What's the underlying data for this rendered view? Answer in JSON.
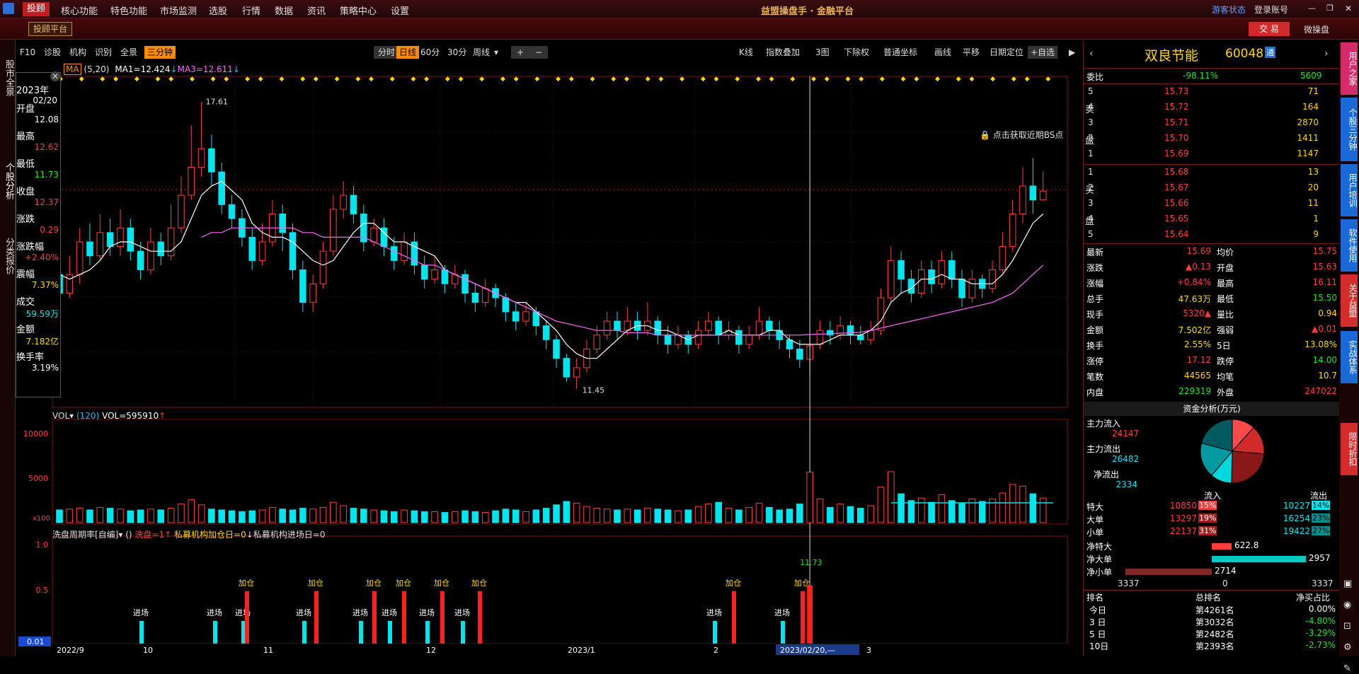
{
  "menu": {
    "items": [
      "投顾",
      "核心功能",
      "特色功能",
      "市场监测",
      "选股",
      "行情",
      "数据",
      "资讯",
      "策略中心",
      "设置"
    ],
    "title": "益盟操盘手 · 金融平台",
    "status": "游客状态",
    "login": "登录账号"
  },
  "toolbar2": {
    "advisor": "投顾平台",
    "trade": "交 易",
    "weipan": "微操盘"
  },
  "left_tabs": [
    "股市全景",
    "个股分析",
    "分类报价"
  ],
  "right_tabs": [
    "用户之家",
    "个股三分钟",
    "用户培训",
    "软件使用",
    "关于益盟",
    "实战体系",
    "限时折扣"
  ],
  "chart_toolbar": {
    "left": [
      "F10",
      "诊股",
      "机构",
      "识别",
      "全景",
      "三分钟"
    ],
    "periods": [
      "分时",
      "日线",
      "60分",
      "30分",
      "周线"
    ],
    "right": [
      "K线",
      "指数叠加",
      "3图",
      "下除权",
      "普通坐标",
      "画线",
      "平移",
      "日期定位",
      "+自选"
    ]
  },
  "ma_line": {
    "label": "MA",
    "params": "(5,20)",
    "ma1": "MA1=12.424",
    "ma3": "MA3=12.611"
  },
  "info_box": {
    "year": "2023年",
    "date": "02/20",
    "rows": [
      [
        "开盘",
        "12.08"
      ],
      [
        "最高",
        "12.62"
      ],
      [
        "最低",
        "11.73"
      ],
      [
        "收盘",
        "12.37"
      ],
      [
        "涨跌",
        "0.29"
      ],
      [
        "涨跌幅",
        "+2.40%"
      ],
      [
        "震幅",
        "7.37%"
      ],
      [
        "成交",
        "59.59万"
      ],
      [
        "金额",
        "7.182亿"
      ],
      [
        "换手率",
        "3.19%"
      ]
    ]
  },
  "chart_notes": {
    "hi": "17.61",
    "lo": "11.45",
    "bs": "点击获取近期BS点",
    "cursor_val": "11.73"
  },
  "vol": {
    "label": "VOL",
    "param": "(120)",
    "value": "VOL=595910",
    "ticks": [
      "10000",
      "5000",
      "x100"
    ]
  },
  "ind": {
    "label": "洗盘周期率[自编]",
    "parts": [
      "()",
      "洗盘=1",
      "私募机构加仓日=0",
      "私募机构进场日=0"
    ],
    "ticks": [
      "1.0",
      "0.5",
      "0.01"
    ],
    "entry": "进场",
    "add": "加仓"
  },
  "xaxis": [
    "2022/9",
    "10",
    "11",
    "12",
    "2023/1",
    "2",
    "2023/02/20,—",
    "3"
  ],
  "quote": {
    "name": "双良节能",
    "code": "600481",
    "weibi_label": "委比",
    "weibi": "-98.11%",
    "weicha": "5609",
    "sell": [
      [
        "5",
        "15.73",
        "71"
      ],
      [
        "4",
        "15.72",
        "164"
      ],
      [
        "3",
        "15.71",
        "2870"
      ],
      [
        "2",
        "15.70",
        "1411"
      ],
      [
        "1",
        "15.69",
        "1147"
      ]
    ],
    "buy": [
      [
        "1",
        "15.68",
        "13"
      ],
      [
        "2",
        "15.67",
        "20"
      ],
      [
        "3",
        "15.66",
        "11"
      ],
      [
        "4",
        "15.65",
        "1"
      ],
      [
        "5",
        "15.64",
        "9"
      ]
    ],
    "sell_label": [
      "卖",
      "盘"
    ],
    "buy_label": [
      "买",
      "盘"
    ],
    "stats": [
      [
        "最新",
        "15.69",
        "均价",
        "15.75"
      ],
      [
        "涨跌",
        "▲0.13",
        "开盘",
        "15.63"
      ],
      [
        "涨幅",
        "+0.84%",
        "最高",
        "16.11"
      ],
      [
        "总手",
        "47.63万",
        "最低",
        "15.50"
      ],
      [
        "现手",
        "5320▲",
        "量比",
        "0.94"
      ],
      [
        "金额",
        "7.502亿",
        "强弱",
        "▲0.01"
      ],
      [
        "换手",
        "2.55%",
        "5日",
        "13.08%"
      ],
      [
        "涨停",
        "17.12",
        "跌停",
        "14.00"
      ],
      [
        "笔数",
        "44565",
        "均笔",
        "10.7"
      ],
      [
        "内盘",
        "229319",
        "外盘",
        "247022"
      ]
    ]
  },
  "funds": {
    "title": "资金分析(万元)",
    "in_label": "主力流入",
    "in": "24147",
    "out_label": "主力流出",
    "out": "26482",
    "net_label": "净流出",
    "net": "2334",
    "col_in": "流入",
    "col_out": "流出",
    "rows": [
      [
        "特大",
        "10850",
        "15%",
        "10227",
        "14%"
      ],
      [
        "大单",
        "13297",
        "19%",
        "16254",
        "23%"
      ],
      [
        "小单",
        "22137",
        "31%",
        "19422",
        "27%"
      ]
    ],
    "net_rows": [
      [
        "净特大",
        "622.8"
      ],
      [
        "净大单",
        "2957"
      ],
      [
        "净小单",
        "2714"
      ]
    ],
    "scale": [
      "3337",
      "0",
      "3337"
    ]
  },
  "rank": {
    "h": [
      "排名",
      "总排名",
      "净买占比"
    ],
    "rows": [
      [
        "今日",
        "第4261名",
        "0.00%"
      ],
      [
        "3 日",
        "第3032名",
        "-4.80%"
      ],
      [
        "5 日",
        "第2482名",
        "-3.29%"
      ],
      [
        "10日",
        "第2393名",
        "-2.73%"
      ]
    ]
  },
  "chart_data": {
    "type": "candlestick",
    "note": "approximate daily K-line 2022/9–2023/3",
    "ylim": [
      11.2,
      18.0
    ],
    "candles": [
      [
        13.9,
        13.5,
        14.2,
        13.2
      ],
      [
        13.5,
        13.9,
        14.3,
        13.4
      ],
      [
        13.9,
        14.6,
        14.9,
        13.7
      ],
      [
        14.6,
        14.3,
        15.0,
        14.1
      ],
      [
        14.3,
        14.8,
        15.2,
        14.2
      ],
      [
        14.8,
        14.5,
        15.1,
        14.3
      ],
      [
        14.5,
        14.9,
        15.3,
        14.3
      ],
      [
        14.9,
        14.4,
        15.1,
        14.2
      ],
      [
        14.4,
        14.0,
        14.6,
        13.8
      ],
      [
        14.0,
        14.6,
        14.9,
        13.9
      ],
      [
        14.6,
        14.3,
        14.8,
        14.1
      ],
      [
        14.3,
        14.9,
        15.4,
        14.2
      ],
      [
        14.9,
        15.6,
        16.0,
        14.8
      ],
      [
        15.6,
        16.2,
        17.1,
        15.5
      ],
      [
        16.2,
        16.6,
        17.61,
        16.0
      ],
      [
        16.6,
        16.1,
        16.9,
        15.8
      ],
      [
        16.1,
        15.4,
        16.3,
        15.2
      ],
      [
        15.4,
        15.1,
        15.6,
        14.9
      ],
      [
        15.1,
        14.7,
        15.3,
        14.5
      ],
      [
        14.7,
        14.2,
        14.9,
        14.0
      ],
      [
        14.2,
        14.6,
        15.0,
        14.1
      ],
      [
        14.6,
        15.2,
        15.5,
        14.5
      ],
      [
        15.2,
        14.8,
        15.4,
        14.4
      ],
      [
        14.8,
        14.0,
        15.0,
        13.8
      ],
      [
        14.0,
        13.3,
        14.2,
        13.1
      ],
      [
        13.3,
        13.7,
        13.9,
        13.1
      ],
      [
        13.7,
        14.4,
        14.6,
        13.6
      ],
      [
        14.4,
        15.3,
        15.6,
        14.3
      ],
      [
        15.3,
        15.6,
        15.9,
        15.1
      ],
      [
        15.6,
        15.2,
        15.8,
        15.0
      ],
      [
        15.2,
        14.6,
        15.4,
        14.4
      ],
      [
        14.6,
        14.9,
        15.1,
        14.5
      ],
      [
        14.9,
        14.5,
        15.1,
        14.3
      ],
      [
        14.5,
        14.2,
        14.7,
        14.0
      ],
      [
        14.2,
        14.6,
        14.8,
        14.1
      ],
      [
        14.6,
        14.1,
        14.8,
        13.9
      ],
      [
        14.1,
        13.8,
        14.3,
        13.6
      ],
      [
        13.8,
        14.0,
        14.3,
        13.7
      ],
      [
        14.0,
        13.7,
        14.1,
        13.5
      ],
      [
        13.7,
        13.9,
        14.1,
        13.6
      ],
      [
        13.9,
        13.5,
        14.0,
        13.3
      ],
      [
        13.5,
        13.3,
        13.7,
        13.1
      ],
      [
        13.3,
        13.6,
        13.8,
        13.2
      ],
      [
        13.6,
        13.4,
        13.7,
        13.2
      ],
      [
        13.4,
        13.1,
        13.5,
        12.9
      ],
      [
        13.1,
        12.9,
        13.3,
        12.7
      ],
      [
        12.9,
        13.1,
        13.3,
        12.8
      ],
      [
        13.1,
        12.8,
        13.2,
        12.6
      ],
      [
        12.8,
        12.5,
        12.9,
        12.3
      ],
      [
        12.5,
        12.1,
        12.6,
        11.9
      ],
      [
        12.1,
        11.7,
        12.2,
        11.6
      ],
      [
        11.7,
        11.9,
        12.1,
        11.45
      ],
      [
        11.9,
        12.3,
        12.5,
        11.8
      ],
      [
        12.3,
        12.6,
        12.8,
        12.2
      ],
      [
        12.6,
        12.9,
        13.1,
        12.5
      ],
      [
        12.9,
        12.7,
        13.1,
        12.5
      ],
      [
        12.7,
        12.9,
        13.2,
        12.6
      ],
      [
        12.9,
        12.7,
        13.1,
        12.5
      ],
      [
        12.7,
        12.9,
        13.3,
        12.6
      ],
      [
        12.9,
        12.6,
        13.0,
        12.4
      ],
      [
        12.6,
        12.4,
        12.8,
        12.2
      ],
      [
        12.4,
        12.6,
        12.8,
        12.3
      ],
      [
        12.6,
        12.4,
        12.7,
        12.2
      ],
      [
        12.4,
        12.7,
        12.9,
        12.3
      ],
      [
        12.7,
        12.9,
        13.1,
        12.6
      ],
      [
        12.9,
        12.6,
        13.0,
        12.4
      ],
      [
        12.6,
        12.7,
        12.9,
        12.5
      ],
      [
        12.7,
        12.4,
        12.8,
        12.2
      ],
      [
        12.4,
        12.6,
        12.8,
        12.3
      ],
      [
        12.6,
        12.9,
        13.2,
        12.5
      ],
      [
        12.9,
        12.7,
        13.0,
        12.5
      ],
      [
        12.7,
        12.5,
        12.9,
        12.3
      ],
      [
        12.5,
        12.3,
        12.6,
        12.1
      ],
      [
        12.3,
        12.08,
        12.5,
        11.9
      ],
      [
        12.08,
        12.37,
        12.62,
        11.73
      ],
      [
        12.4,
        12.7,
        12.9,
        12.3
      ],
      [
        12.7,
        12.6,
        12.9,
        12.4
      ],
      [
        12.6,
        12.8,
        13.0,
        12.5
      ],
      [
        12.8,
        12.6,
        12.9,
        12.4
      ],
      [
        12.6,
        12.5,
        12.8,
        12.4
      ],
      [
        12.5,
        12.7,
        12.9,
        12.4
      ],
      [
        12.7,
        13.4,
        13.6,
        12.6
      ],
      [
        13.4,
        14.2,
        14.5,
        13.3
      ],
      [
        14.2,
        13.8,
        14.4,
        13.5
      ],
      [
        13.8,
        13.5,
        14.0,
        13.3
      ],
      [
        13.5,
        14.0,
        14.2,
        13.4
      ],
      [
        14.0,
        13.7,
        14.2,
        13.5
      ],
      [
        13.7,
        14.2,
        14.4,
        13.6
      ],
      [
        14.2,
        13.8,
        14.4,
        13.6
      ],
      [
        13.8,
        13.4,
        14.0,
        13.2
      ],
      [
        13.4,
        13.8,
        14.0,
        13.3
      ],
      [
        13.8,
        13.6,
        13.9,
        13.4
      ],
      [
        13.6,
        14.0,
        14.2,
        13.5
      ],
      [
        14.0,
        14.5,
        14.8,
        13.9
      ],
      [
        14.5,
        15.2,
        15.5,
        14.4
      ],
      [
        15.2,
        15.8,
        16.2,
        15.0
      ],
      [
        15.8,
        15.5,
        16.4,
        15.2
      ],
      [
        15.5,
        15.69,
        16.11,
        15.5
      ]
    ],
    "volume": [
      1500,
      1600,
      1700,
      1500,
      1800,
      1700,
      1600,
      1400,
      1500,
      1600,
      1500,
      1700,
      2200,
      2700,
      2100,
      1600,
      1500,
      1400,
      1300,
      1400,
      1500,
      1800,
      1600,
      1500,
      1700,
      1600,
      1800,
      2400,
      2000,
      1700,
      1600,
      1500,
      1400,
      1300,
      1500,
      1400,
      1300,
      1300,
      1200,
      1300,
      1400,
      1300,
      1200,
      1400,
      1600,
      1500,
      1300,
      1500,
      1700,
      2100,
      2500,
      2300,
      1900,
      1700,
      1600,
      1500,
      1600,
      1500,
      1700,
      1600,
      1500,
      1400,
      1500,
      1900,
      2200,
      2400,
      1700,
      1500,
      1800,
      2300,
      1800,
      1500,
      1600,
      2200,
      5960,
      2800,
      1800,
      2200,
      1900,
      1700,
      2000,
      4200,
      6000,
      3400,
      2600,
      2900,
      2400,
      3300,
      2600,
      2300,
      2800,
      2500,
      2800,
      3500,
      4500,
      4300,
      3400,
      2900
    ],
    "ma1": [
      13.9,
      13.8,
      13.9,
      14.0,
      14.2,
      14.5,
      14.6,
      14.6,
      14.5,
      14.4,
      14.4,
      14.4,
      14.6,
      15.1,
      15.6,
      15.8,
      15.9,
      15.7,
      15.5,
      15.0,
      14.8,
      14.7,
      14.7,
      14.6,
      14.4,
      14.2,
      14.1,
      14.2,
      14.5,
      14.8,
      15.0,
      15.0,
      14.8,
      14.6,
      14.6,
      14.5,
      14.4,
      14.3,
      14.0,
      13.9,
      13.8,
      13.7,
      13.6,
      13.5,
      13.4,
      13.3,
      13.3,
      13.1,
      12.9,
      12.7,
      12.4,
      12.2,
      12.1,
      12.1,
      12.3,
      12.5,
      12.7,
      12.8,
      12.8,
      12.7,
      12.7,
      12.6,
      12.5,
      12.6,
      12.6,
      12.6,
      12.7,
      12.6,
      12.6,
      12.6,
      12.7,
      12.7,
      12.5,
      12.4,
      12.4,
      12.4,
      12.5,
      12.6,
      12.6,
      12.6,
      12.7,
      12.9,
      13.3,
      13.5,
      13.6,
      13.8,
      13.8,
      13.9,
      13.8,
      13.8,
      13.7,
      13.7,
      13.7,
      13.9,
      14.2,
      14.6,
      15.0,
      15.2
    ],
    "ma3": [
      null,
      null,
      null,
      null,
      null,
      null,
      null,
      null,
      null,
      null,
      null,
      null,
      null,
      null,
      14.7,
      14.8,
      14.8,
      14.9,
      14.9,
      14.9,
      14.9,
      14.9,
      14.9,
      14.9,
      14.8,
      14.8,
      14.7,
      14.7,
      14.7,
      14.7,
      14.7,
      14.6,
      14.5,
      14.4,
      14.3,
      14.2,
      14.1,
      14.1,
      14.0,
      13.9,
      13.8,
      13.7,
      13.6,
      13.5,
      13.4,
      13.3,
      13.2,
      13.1,
      13.0,
      12.9,
      12.85,
      12.8,
      12.75,
      12.7,
      12.7,
      12.7,
      12.65,
      12.65,
      12.65,
      12.6,
      12.6,
      12.6,
      12.6,
      12.6,
      12.6,
      12.6,
      12.6,
      12.6,
      12.6,
      12.6,
      12.6,
      12.6,
      12.6,
      12.6,
      12.611,
      12.62,
      12.63,
      12.64,
      12.65,
      12.66,
      12.7,
      12.75,
      12.8,
      12.85,
      12.9,
      12.95,
      13.0,
      13.05,
      13.1,
      13.15,
      13.2,
      13.25,
      13.3,
      13.4,
      13.5,
      13.7,
      13.9,
      14.1
    ]
  }
}
